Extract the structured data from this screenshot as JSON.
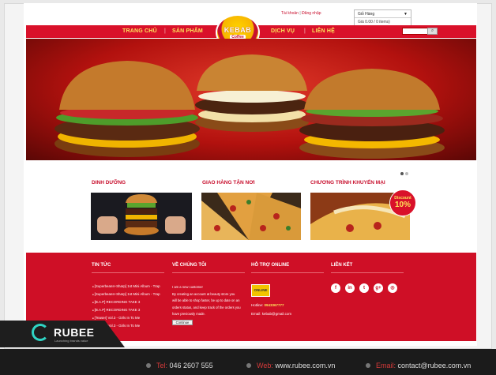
{
  "topbar": {
    "account_label": "Tài khoản",
    "login_label": "Đăng nhập",
    "cart_title": "Giỏ Hàng",
    "cart_summary": "Giá 0.00    / 0 items)"
  },
  "nav": {
    "items": [
      "TRANG CHỦ",
      "SẢN PHẨM",
      "DỊCH VỤ",
      "LIÊN HỆ"
    ],
    "separator": "|",
    "logo_text": "KEBAB",
    "logo_sub": "Coffee"
  },
  "sections": {
    "titles": [
      "DINH DƯỠNG",
      "GIAO HÀNG TẬN NƠI",
      "CHƯƠNG TRÌNH KHUYẾN MẠI"
    ],
    "discount_label": "Discount",
    "discount_value": "10%"
  },
  "footer": {
    "headings": [
      "TIN TỨC",
      "VỀ CHÚNG TÔI",
      "HỖ TRỢ ONLINE",
      "LIÊN KẾT"
    ],
    "news": [
      "[Superbeans+Sharp] 1st Mini Album - Trap",
      "[Superbeans+Sharp] 1st Mini Album - Trap",
      "[B.A.P] RECORDING TAKE 3",
      "[B.A.P] RECORDING TAKE 3",
      "[Teaser] Vol.3 - Girls In To Me",
      "[Teaser] Vol.3 - Girls In To Me"
    ],
    "about_lines": [
      "I am a new customer",
      "By creating an account at beauty store you",
      "will be able to shop faster, be up to date on an",
      "orders status, and keep track of the orders you",
      "have previously made."
    ],
    "continue_label": "Continue",
    "support_badge": "ONLINE",
    "hotline_label": "Hotline:",
    "hotline_value": "0943367777",
    "email_label": "Email:",
    "email_value": "kebab@gmail.com",
    "social": [
      "f",
      "in",
      "t",
      "g+",
      "◎"
    ]
  },
  "brand": {
    "name": "RUBEE",
    "tagline": "Launching brands value"
  },
  "contact_strip": {
    "tel_label": "Tel:",
    "tel_value": "046 2607 555",
    "web_label": "Web:",
    "web_value": "www.rubee.com.vn",
    "email_label": "Email:",
    "email_value": "contact@rubee.com.vn"
  },
  "colors": {
    "primary_red": "#d9112a",
    "nav_text": "#fde35a",
    "accent_teal": "#2fd5c5",
    "strip_bg": "#1b1b1b"
  }
}
